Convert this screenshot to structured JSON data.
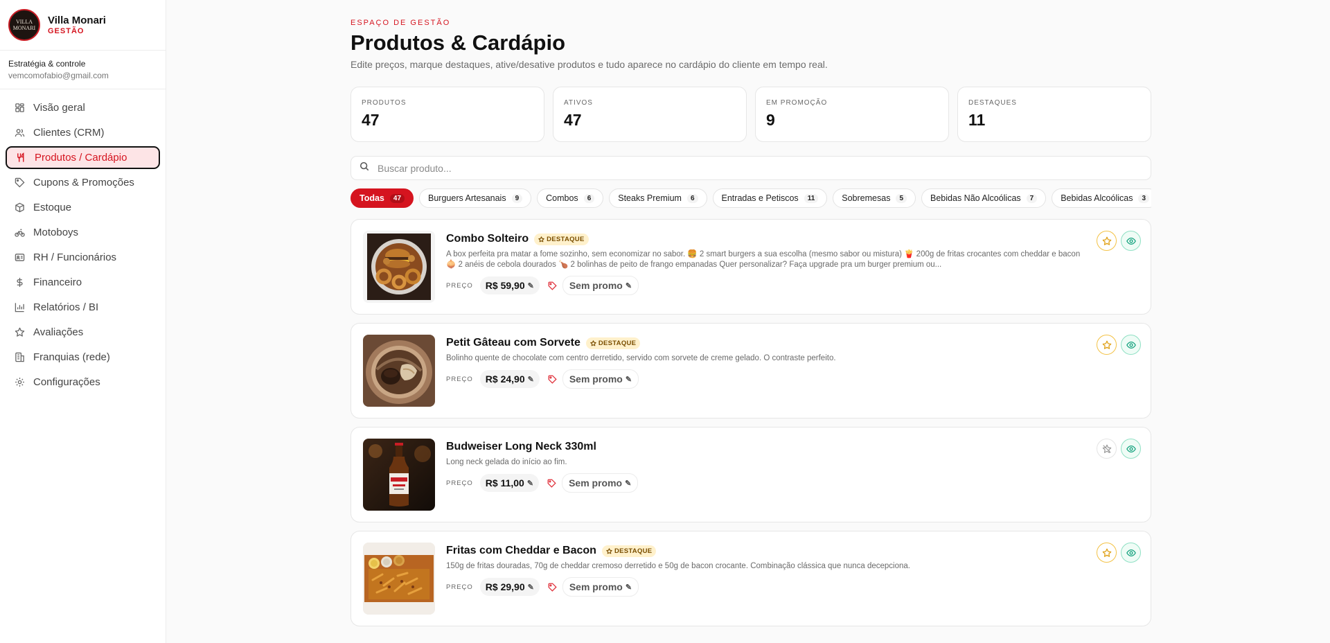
{
  "brand": {
    "name": "Villa Monari",
    "sub": "GESTÃO",
    "logo_line1": "VILLA",
    "logo_line2": "MONARI"
  },
  "account": {
    "title": "Estratégia & controle",
    "email": "vemcomofabio@gmail.com"
  },
  "nav": [
    {
      "label": "Visão geral",
      "icon": "grid-icon"
    },
    {
      "label": "Clientes (CRM)",
      "icon": "users-icon"
    },
    {
      "label": "Produtos / Cardápio",
      "icon": "utensils-icon",
      "active": true
    },
    {
      "label": "Cupons & Promoções",
      "icon": "tag-icon"
    },
    {
      "label": "Estoque",
      "icon": "box-icon"
    },
    {
      "label": "Motoboys",
      "icon": "bike-icon"
    },
    {
      "label": "RH / Funcionários",
      "icon": "id-card-icon"
    },
    {
      "label": "Financeiro",
      "icon": "dollar-icon"
    },
    {
      "label": "Relatórios / BI",
      "icon": "bar-chart-icon"
    },
    {
      "label": "Avaliações",
      "icon": "star-icon"
    },
    {
      "label": "Franquias (rede)",
      "icon": "building-icon"
    },
    {
      "label": "Configurações",
      "icon": "gear-icon"
    }
  ],
  "header": {
    "eyebrow": "ESPAÇO DE GESTÃO",
    "title": "Produtos & Cardápio",
    "subtitle": "Edite preços, marque destaques, ative/desative produtos e tudo aparece no cardápio do cliente em tempo real."
  },
  "stats": [
    {
      "label": "PRODUTOS",
      "value": "47"
    },
    {
      "label": "ATIVOS",
      "value": "47"
    },
    {
      "label": "EM PROMOÇÃO",
      "value": "9"
    },
    {
      "label": "DESTAQUES",
      "value": "11"
    }
  ],
  "search": {
    "placeholder": "Buscar produto..."
  },
  "categories": [
    {
      "label": "Todas",
      "count": "47",
      "active": true
    },
    {
      "label": "Burguers Artesanais",
      "count": "9"
    },
    {
      "label": "Combos",
      "count": "6"
    },
    {
      "label": "Steaks Premium",
      "count": "6"
    },
    {
      "label": "Entradas e Petiscos",
      "count": "11"
    },
    {
      "label": "Sobremesas",
      "count": "5"
    },
    {
      "label": "Bebidas Não Alcoólicas",
      "count": "7"
    },
    {
      "label": "Bebidas Alcoólicas",
      "count": "3"
    }
  ],
  "labels": {
    "price": "PREÇO",
    "badge": "DESTAQUE",
    "edit_glyph": "✎"
  },
  "products": [
    {
      "name": "Combo Solteiro",
      "featured": true,
      "description": "A box perfeita pra matar a fome sozinho, sem economizar no sabor. 🍔 2 smart burgers a sua escolha (mesmo sabor ou mistura) 🍟 200g de fritas crocantes com cheddar e bacon 🧅 2 anéis de cebola dourados 🍗 2 bolinhas de peito de frango empanadas Quer personalizar? Faça upgrade pra um burger premium ou...",
      "price": "R$ 59,90",
      "promo": "Sem promo",
      "image": "combo-food"
    },
    {
      "name": "Petit Gâteau com Sorvete",
      "featured": true,
      "description": "Bolinho quente de chocolate com centro derretido, servido com sorvete de creme gelado. O contraste perfeito.",
      "price": "R$ 24,90",
      "promo": "Sem promo",
      "image": "dessert"
    },
    {
      "name": "Budweiser Long Neck 330ml",
      "featured": false,
      "description": "Long neck gelada do início ao fim.",
      "price": "R$ 11,00",
      "promo": "Sem promo",
      "image": "beer"
    },
    {
      "name": "Fritas com Cheddar e Bacon",
      "featured": true,
      "description": "150g de fritas douradas, 70g de cheddar cremoso derretido e 50g de bacon crocante. Combinação clássica que nunca decepciona.",
      "price": "R$ 29,90",
      "promo": "Sem promo",
      "image": "fries"
    }
  ],
  "colors": {
    "accent": "#d5141f",
    "badge_bg": "#fff1cc",
    "eye": "#16a37f",
    "star": "#e0a21a"
  }
}
